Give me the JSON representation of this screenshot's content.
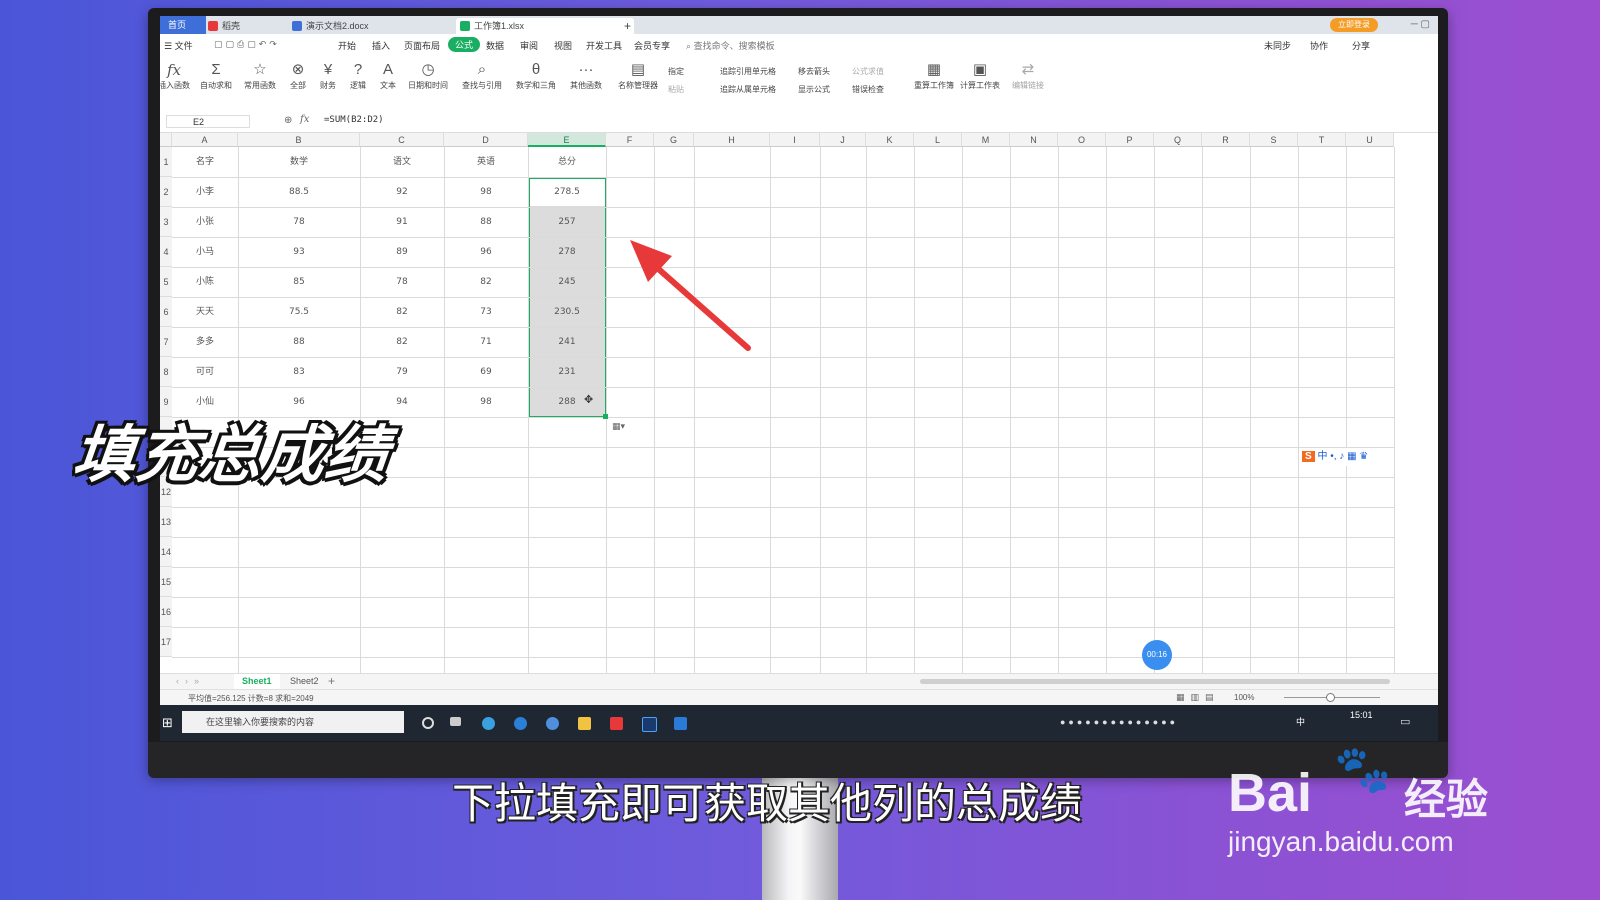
{
  "titlebar": {
    "tabs": [
      {
        "label": "首页"
      },
      {
        "label": "稻壳"
      },
      {
        "label": "演示文档2.docx"
      },
      {
        "label": "工作簿1.xlsx"
      }
    ],
    "new_tab": "+",
    "login": "立即登录"
  },
  "menubar": {
    "file": "文件",
    "items": [
      "开始",
      "插入",
      "页面布局",
      "公式",
      "数据",
      "审阅",
      "视图",
      "开发工具",
      "会员专享"
    ],
    "active": "公式",
    "search_placeholder": "查找命令、搜索模板",
    "right": [
      "未同步",
      "协作",
      "分享"
    ]
  },
  "ribbon": {
    "buttons": [
      {
        "icon": "fx-icon",
        "glyph": "fx",
        "label": "插入函数"
      },
      {
        "icon": "sum-icon",
        "glyph": "Σ",
        "label": "自动求和"
      },
      {
        "icon": "star-icon",
        "glyph": "☆",
        "label": "常用函数"
      },
      {
        "icon": "all-icon",
        "glyph": "⊗",
        "label": "全部"
      },
      {
        "icon": "finance-icon",
        "glyph": "¥",
        "label": "财务"
      },
      {
        "icon": "logic-icon",
        "glyph": "?",
        "label": "逻辑"
      },
      {
        "icon": "text-icon",
        "glyph": "A",
        "label": "文本"
      },
      {
        "icon": "datetime-icon",
        "glyph": "◷",
        "label": "日期和时间"
      },
      {
        "icon": "lookup-icon",
        "glyph": "⌕",
        "label": "查找与引用"
      },
      {
        "icon": "math-icon",
        "glyph": "θ",
        "label": "数学和三角"
      },
      {
        "icon": "more-icon",
        "glyph": "···",
        "label": "其他函数"
      },
      {
        "icon": "name-manager-icon",
        "glyph": "▤",
        "label": "名称管理器"
      }
    ],
    "small": [
      "指定",
      "粘贴",
      "追踪引用单元格",
      "追踪从属单元格",
      "移去箭头",
      "显示公式",
      "错误检查",
      "公式求值"
    ],
    "right_buttons": [
      {
        "icon": "recalc-icon",
        "glyph": "▦",
        "label": "重算工作簿"
      },
      {
        "icon": "calc-sheet-icon",
        "glyph": "▣",
        "label": "计算工作表"
      },
      {
        "icon": "edit-link-icon",
        "glyph": "⇄",
        "label": "编辑链接"
      }
    ]
  },
  "formula_bar": {
    "cell_ref": "E2",
    "fx": "fx",
    "formula": "=SUM(B2:D2)"
  },
  "sheet": {
    "columns": [
      "A",
      "B",
      "C",
      "D",
      "E",
      "F",
      "G",
      "H",
      "I",
      "J",
      "K",
      "L",
      "M",
      "N",
      "O",
      "P",
      "Q",
      "R",
      "S",
      "T",
      "U"
    ],
    "row_numbers": [
      "1",
      "2",
      "3",
      "4",
      "5",
      "6",
      "7",
      "8",
      "9",
      "",
      "",
      "12",
      "13",
      "14",
      "15",
      "16",
      "17"
    ],
    "header": [
      "名字",
      "数学",
      "语文",
      "英语",
      "总分"
    ],
    "rows": [
      [
        "小李",
        "88.5",
        "92",
        "98",
        "278.5"
      ],
      [
        "小张",
        "78",
        "91",
        "88",
        "257"
      ],
      [
        "小马",
        "93",
        "89",
        "96",
        "278"
      ],
      [
        "小陈",
        "85",
        "78",
        "82",
        "245"
      ],
      [
        "天天",
        "75.5",
        "82",
        "73",
        "230.5"
      ],
      [
        "多多",
        "88",
        "82",
        "71",
        "241"
      ],
      [
        "可可",
        "83",
        "79",
        "69",
        "231"
      ],
      [
        "小仙",
        "96",
        "94",
        "98",
        "288"
      ]
    ]
  },
  "sheet_tabs": [
    "Sheet1",
    "Sheet2"
  ],
  "status": {
    "summary": "平均值=256.125  计数=8  求和=2049",
    "zoom": "100%"
  },
  "taskbar": {
    "search_placeholder": "在这里输入你要搜索的内容",
    "time": "15:01",
    "ime": "中"
  },
  "ime_toolbar": "中",
  "timer": "00:16",
  "overlay_title": "填充总成绩",
  "subtitle": "下拉填充即可获取其他列的总成绩",
  "watermark": {
    "brand": "Bai",
    "brand2": "经验",
    "url": "jingyan.baidu.com"
  },
  "colors": {
    "accent_green": "#1aae62",
    "arrow_red": "#e8393a",
    "background": "#6f5bdc"
  }
}
